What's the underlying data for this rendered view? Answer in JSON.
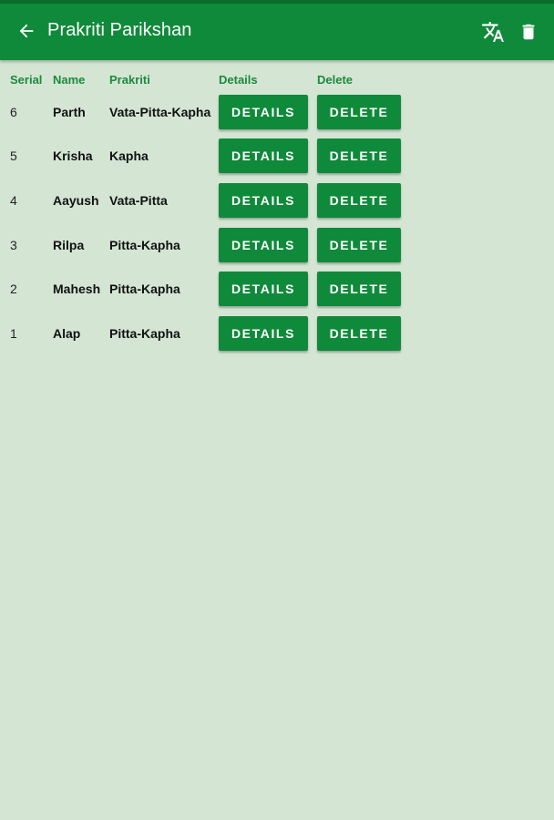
{
  "appbar": {
    "title": "Prakriti Parikshan",
    "back_icon": "arrow-left-icon",
    "translate_icon": "translate-icon",
    "trash_icon": "trash-icon",
    "color": "#0f8a3a"
  },
  "table": {
    "headers": {
      "serial": "Serial",
      "name": "Name",
      "prakriti": "Prakriti",
      "details": "Details",
      "delete": "Delete"
    },
    "rows": [
      {
        "serial": "6",
        "name": "Parth",
        "prakriti": "Vata-Pitta-Kapha",
        "details_label": "DETAILS",
        "delete_label": "DELETE"
      },
      {
        "serial": "5",
        "name": "Krisha",
        "prakriti": "Kapha",
        "details_label": "DETAILS",
        "delete_label": "DELETE"
      },
      {
        "serial": "4",
        "name": "Aayush",
        "prakriti": "Vata-Pitta",
        "details_label": "DETAILS",
        "delete_label": "DELETE"
      },
      {
        "serial": "3",
        "name": "Rilpa",
        "prakriti": "Pitta-Kapha",
        "details_label": "DETAILS",
        "delete_label": "DELETE"
      },
      {
        "serial": "2",
        "name": "Mahesh",
        "prakriti": "Pitta-Kapha",
        "details_label": "DETAILS",
        "delete_label": "DELETE"
      },
      {
        "serial": "1",
        "name": "Alap",
        "prakriti": "Pitta-Kapha",
        "details_label": "DETAILS",
        "delete_label": "DELETE"
      }
    ]
  },
  "colors": {
    "background": "#d4e5d4",
    "accent": "#0f8a3a",
    "header_text": "#1b8a3c"
  }
}
